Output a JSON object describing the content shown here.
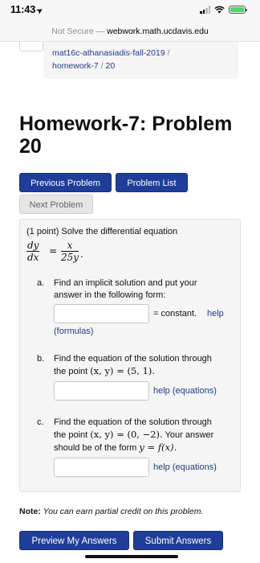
{
  "status_bar": {
    "time": "11:43",
    "location_arrow": "➤",
    "signal_icon": "cellular-signal",
    "wifi_icon": "wifi",
    "battery_icon": "battery-charging",
    "battery_color": "#4cd964"
  },
  "url_bar": {
    "security_label": "Not Secure",
    "separator": "—",
    "domain": "webwork.math.ucdavis.edu"
  },
  "breadcrumb": {
    "course": "mat16c-athanasiadis-fall-2019",
    "sep": "/",
    "set": "homework-7",
    "problem": "20"
  },
  "page_title": "Homework-7: Problem 20",
  "nav": {
    "previous_label": "Previous Problem",
    "list_label": "Problem List",
    "next_label": "Next Problem"
  },
  "problem": {
    "intro": "(1 point) Solve the differential equation",
    "lhs_num": "dy",
    "lhs_den": "dx",
    "equals": "=",
    "rhs_num": "x",
    "rhs_den": "25y",
    "period": ".",
    "parts": [
      {
        "letter": "a.",
        "line1": "Find an implicit solution and put your",
        "line2": "answer in the following form:",
        "suffix": "= constant.",
        "help": "help",
        "help2": "(formulas)",
        "value": ""
      },
      {
        "letter": "b.",
        "line1": "Find the equation of the solution through",
        "line2_pre": "the point",
        "point": "(x, y) = (5, 1).",
        "help": "help (equations)",
        "value": ""
      },
      {
        "letter": "c.",
        "line1": "Find the equation of the solution through",
        "line2_pre": "the point",
        "point": "(x, y) = (0, −2).",
        "line2_post": "Your answer",
        "line3_pre": "should be of the form",
        "form": "y = f(x).",
        "help": "help (equations)",
        "value": ""
      }
    ]
  },
  "note": {
    "label": "Note:",
    "text": "You can earn partial credit on this problem."
  },
  "actions": {
    "preview_label": "Preview My Answers",
    "submit_label": "Submit Answers"
  },
  "colors": {
    "primary": "#1e3e9a",
    "link": "#1f3d8a",
    "panel": "#f5f5f5"
  }
}
